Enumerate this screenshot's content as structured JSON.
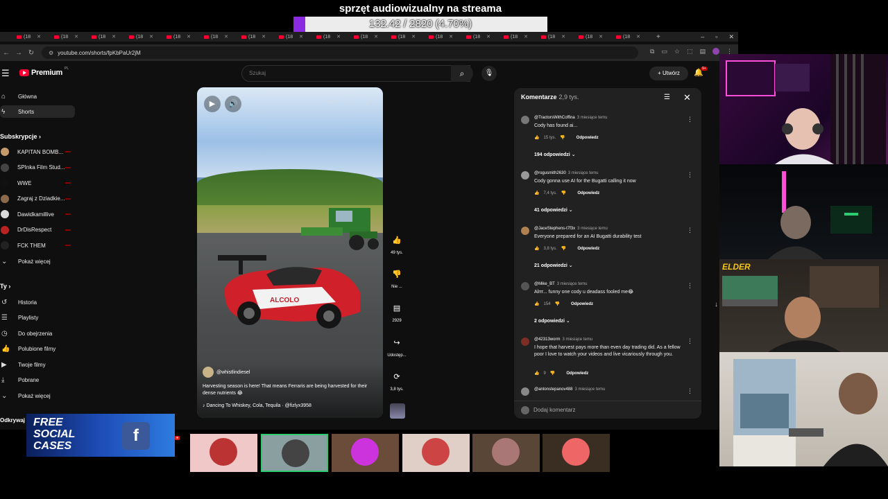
{
  "stream_goal": {
    "title": "sprzęt audiowizualny na streama",
    "progress_text": "132.42 / 2820 (4.70%)",
    "progress_fraction": 0.047,
    "accent_color": "#8a2be2"
  },
  "browser": {
    "tab_label": "(18",
    "tab_count": 17,
    "new_tab_icon": "plus-icon",
    "url": "youtube.com/shorts/fpKbPaUr2jM"
  },
  "header": {
    "logo_text": "Premium",
    "logo_region": "PL",
    "search_placeholder": "Szukaj",
    "create_label": "Utwórz",
    "notification_badge": "9+"
  },
  "sidebar": {
    "main": [
      {
        "label": "Główna",
        "icon": "home-icon"
      },
      {
        "label": "Shorts",
        "icon": "shorts-icon",
        "active": true
      }
    ],
    "subscriptions_heading": "Subskrypcje",
    "subscriptions": [
      {
        "label": "KAPITAN BOMB...",
        "color": "#c79a6a"
      },
      {
        "label": "SPInka Film Stud...",
        "color": "#444"
      },
      {
        "label": "WWE",
        "color": "#111"
      },
      {
        "label": "Zagraj z Dziadkie...",
        "color": "#8a6a4a"
      },
      {
        "label": "Dawidkamillive",
        "color": "#d9d9d9"
      },
      {
        "label": "DrDisRespect",
        "color": "#b22"
      },
      {
        "label": "FCK THEM",
        "color": "#222"
      }
    ],
    "show_more_label": "Pokaż więcej",
    "you_heading": "Ty",
    "you_items": [
      {
        "label": "Historia",
        "icon": "history-icon"
      },
      {
        "label": "Playlisty",
        "icon": "playlist-icon"
      },
      {
        "label": "Do obejrzenia",
        "icon": "clock-icon"
      },
      {
        "label": "Polubione filmy",
        "icon": "thumbs-up-icon"
      },
      {
        "label": "Twoje filmy",
        "icon": "video-icon"
      },
      {
        "label": "Pobrane",
        "icon": "download-icon"
      }
    ],
    "show_more_label_2": "Pokaż więcej",
    "discover_heading": "Odkrywaj"
  },
  "short": {
    "channel": "@whistlindiesel",
    "description": "Harvesting season is here! That means Ferraris are being harvested for their dense nutrients 😂",
    "music": "Dancing To Whiskey, Cola, Tequila · @fizlyx3958",
    "car_brand": "ALCOLO"
  },
  "actions": {
    "likes": "49 tys.",
    "dislike_label": "Nie ...",
    "comments": "2929",
    "share_label": "Udostęp...",
    "remix_count": "3,8 tys."
  },
  "comments": {
    "title": "Komentarze",
    "count": "2,9 tys.",
    "input_placeholder": "Dodaj komentarz",
    "reply_label": "Odpowiedz",
    "items": [
      {
        "user": "@TractorsWithCoffina",
        "time": "3 miesiące temu",
        "text": "Cody has found ai...",
        "likes": "15 tys.",
        "replies": "194 odpowiedzi",
        "color": "#777"
      },
      {
        "user": "@rogusmith2630",
        "time": "3 miesiące temu",
        "text": "Cody gonna use AI for the Bugatti calling it now",
        "likes": "7,4 tys.",
        "replies": "41 odpowiedzi",
        "color": "#999"
      },
      {
        "user": "@JaceStephens-t7f3x",
        "time": "3 miesiące temu",
        "text": "Everyone prepared for an AI Bugatti durability test",
        "likes": "3,8 tys.",
        "replies": "21 odpowiedzi",
        "color": "#b08050"
      },
      {
        "user": "@Mike_BT",
        "time": "3 miesiące temu",
        "text": "Alrrr... funny one cody u deadass fooled me😂",
        "likes": "154",
        "replies": "2 odpowiedzi",
        "color": "#555"
      },
      {
        "user": "@42313worm",
        "time": "3 miesiące temu",
        "text": "I hope that harvest pays more than even day trading did. As a fellow poor I love to watch your videos and live vicariously through you.",
        "likes": "9",
        "replies": "",
        "color": "#7b2d26"
      },
      {
        "user": "@antonstepanov488",
        "time": "3 miesiące temu",
        "text": "",
        "likes": "",
        "replies": "",
        "color": "#888"
      }
    ]
  },
  "webcams": {
    "cam3_overlay": "ELDER"
  },
  "ad": {
    "line1": "FREE",
    "line2": "SOCIAL",
    "line3": "CASES",
    "logo": "f"
  },
  "viewers": [
    {
      "bg": "#f0c8c8",
      "face": "#b33"
    },
    {
      "bg": "#8aa0a0",
      "face": "#444"
    },
    {
      "bg": "#6b4b3a",
      "face": "#c3d"
    },
    {
      "bg": "#e0cfc6",
      "face": "#c44"
    },
    {
      "bg": "#5a4637",
      "face": "#a77"
    },
    {
      "bg": "#3a2d22",
      "face": "#e66"
    }
  ]
}
